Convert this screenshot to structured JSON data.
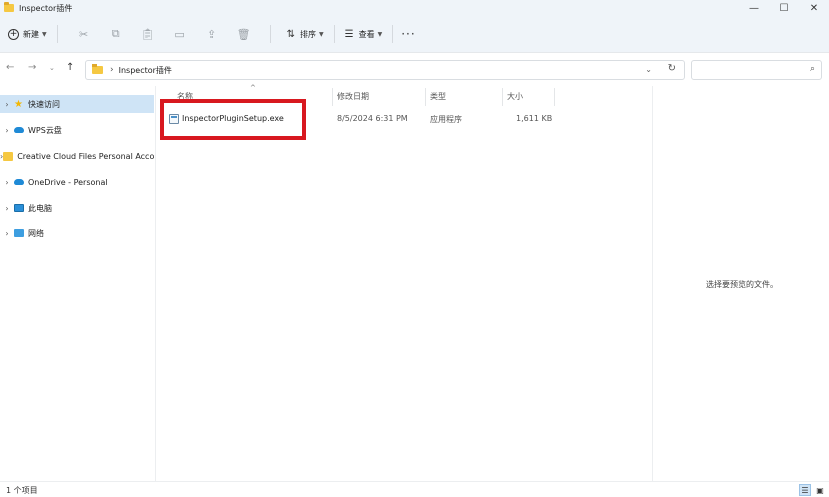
{
  "window": {
    "title": "Inspector插件",
    "minimize": "—",
    "maximize": "☐",
    "close": "✕"
  },
  "toolbar": {
    "new_label": "新建",
    "new_glyph": "+",
    "sort_label": "排序",
    "view_label": "查看",
    "more_label": "···",
    "icons": [
      "cut-icon",
      "copy-icon",
      "paste-icon",
      "rename-icon",
      "share-icon",
      "delete-icon"
    ]
  },
  "address": {
    "path": "Inspector插件",
    "search_placeholder": ""
  },
  "sidebar": {
    "items": [
      {
        "label": "快速访问",
        "icon": "star-icon",
        "selected": true
      },
      {
        "label": "WPS云盘",
        "icon": "cloud-icon",
        "selected": false
      },
      {
        "label": "Creative Cloud Files Personal Account",
        "icon": "folder-icon",
        "selected": false
      },
      {
        "label": "OneDrive - Personal",
        "icon": "onedrive-icon",
        "selected": false
      },
      {
        "label": "此电脑",
        "icon": "computer-icon",
        "selected": false
      },
      {
        "label": "网络",
        "icon": "network-icon",
        "selected": false
      }
    ]
  },
  "columns": {
    "name": "名称",
    "modified": "修改日期",
    "type": "类型",
    "size": "大小"
  },
  "files": [
    {
      "name": "InspectorPluginSetup.exe",
      "modified": "8/5/2024 6:31 PM",
      "type": "应用程序",
      "size": "1,611 KB"
    }
  ],
  "preview": {
    "message": "选择要预览的文件。"
  },
  "status": {
    "item_count": "1 个项目"
  },
  "colors": {
    "highlight": "#d8181f",
    "selection": "#cfe4f6",
    "chrome": "#eff4f9"
  }
}
